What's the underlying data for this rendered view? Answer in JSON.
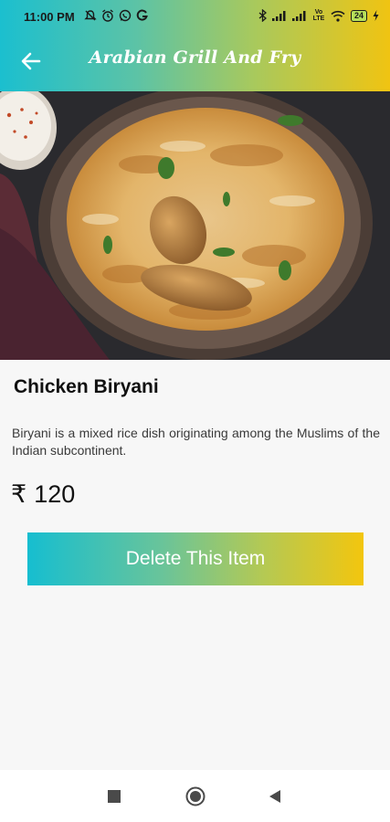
{
  "status_bar": {
    "time": "11:00 PM",
    "battery": "24",
    "left_icons": [
      "mute-icon",
      "alarm-icon",
      "whatsapp-icon",
      "google-icon"
    ],
    "right_icons": [
      "bluetooth-icon",
      "signal-icon",
      "signal-icon",
      "volte-icon",
      "wifi-icon",
      "battery-icon",
      "charging-icon"
    ],
    "volte_text": "Vo LTE"
  },
  "app_bar": {
    "title": "Arabian Grill And Fry",
    "back_icon": "arrow-left-icon"
  },
  "item": {
    "name": "Chicken Biryani",
    "description": "Biryani is a mixed rice dish originating among the Muslims of the Indian subcontinent.",
    "currency": "₹",
    "price": "120"
  },
  "actions": {
    "delete_label": "Delete This Item"
  },
  "nav_bar": {
    "icons": [
      "recents-square-icon",
      "home-circle-icon",
      "back-triangle-icon"
    ]
  },
  "colors": {
    "gradient_start": "#1bbfcf",
    "gradient_end": "#f0c412"
  }
}
